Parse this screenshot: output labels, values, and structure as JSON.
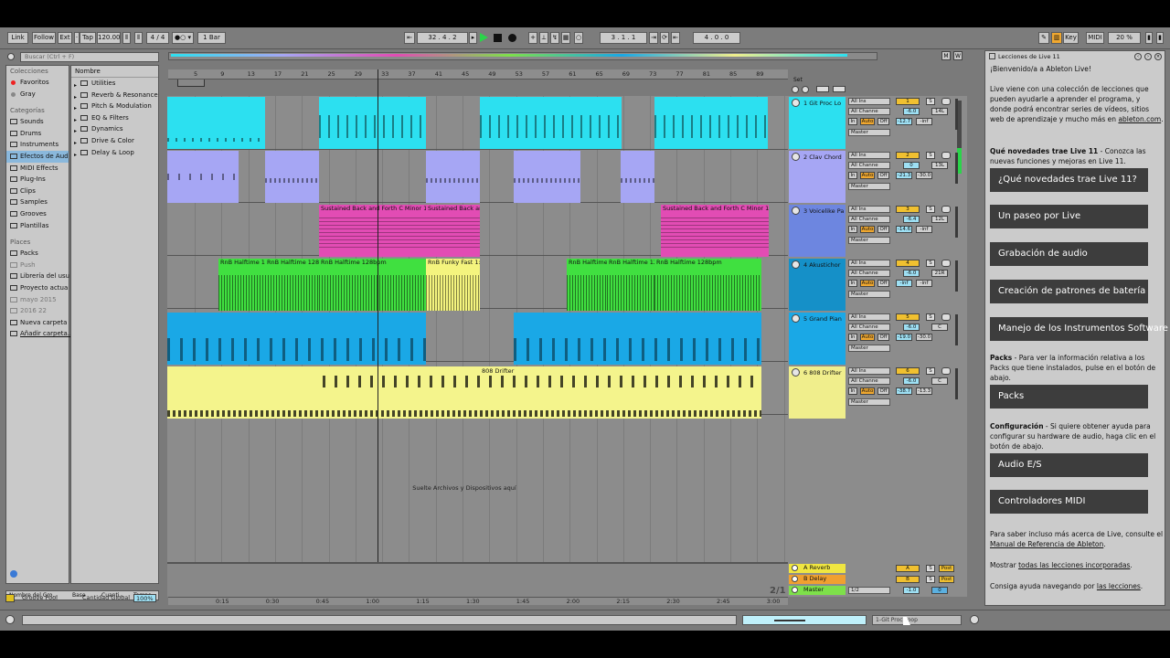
{
  "transport": {
    "link": "Link",
    "follow": "Follow",
    "ext": "Ext",
    "tap": "Tap",
    "tempo": "120.00",
    "meter": "4 / 4",
    "quant": "1 Bar",
    "position": "32 .  4 .  2",
    "loop_start": "3 .  1 .  1",
    "loop_length": "4 .  0 .  0",
    "key": "Key",
    "midi": "MIDI",
    "cpu": "20 %"
  },
  "browser": {
    "search_placeholder": "Buscar (Ctrl + F)",
    "colecciones_header": "Colecciones",
    "colecciones": [
      "Favoritos",
      "Gray"
    ],
    "categorias_header": "Categorías",
    "categorias": [
      "Sounds",
      "Drums",
      "Instruments",
      "Efectos de Aud",
      "MIDI Effects",
      "Plug-Ins",
      "Clips",
      "Samples",
      "Grooves",
      "Plantillas"
    ],
    "places_header": "Places",
    "places": [
      "Packs",
      "Push",
      "Librería del usu",
      "Proyecto actua",
      "mayo 2015",
      "2016 22",
      "Nueva carpeta",
      "Añadir carpeta..."
    ],
    "name_header": "Nombre",
    "items": [
      "Utilities",
      "Reverb & Resonance",
      "Pitch & Modulation",
      "EQ & Filters",
      "Dynamics",
      "Drive & Color",
      "Delay & Loop"
    ],
    "groove_cols": [
      "Nombre del Gro...",
      "Base",
      "Cuanti...",
      "Tempo..."
    ],
    "groove_pool": "Groove Pool",
    "global_amount_label": "Cantidad Global",
    "global_amount": "100%"
  },
  "arrangement": {
    "bars": [
      "5",
      "9",
      "13",
      "17",
      "21",
      "25",
      "29",
      "33",
      "37",
      "41",
      "45",
      "49",
      "53",
      "57",
      "61",
      "65",
      "69",
      "73",
      "77",
      "81",
      "85",
      "89"
    ],
    "set_label": "Set",
    "drop_hint": "Suelte Archivos y Dispositivos aquí",
    "time_labels": [
      "0:15",
      "0:30",
      "0:45",
      "1:00",
      "1:15",
      "1:30",
      "1:45",
      "2:00",
      "2:15",
      "2:30",
      "2:45",
      "3:00"
    ],
    "zoom": "2/1",
    "status_track": "1-Git Proc Loop"
  },
  "tracks": [
    {
      "name": "1 Git Proc Lo",
      "color": "#2ce0f0",
      "num": "1",
      "vol": "-6.0",
      "pan": "14L",
      "send_a": "-12.7",
      "send_b": "-inf",
      "in_type": "All Ins",
      "in_ch": "All Channe",
      "out": "Master"
    },
    {
      "name": "2 Clav Chord",
      "color": "#a6a6f4",
      "num": "2",
      "vol": "0",
      "pan": "13L",
      "send_a": "-21.3",
      "send_b": "-30.0",
      "in_type": "All Ins",
      "in_ch": "All Channe",
      "out": "Master"
    },
    {
      "name": "3 Voicelike Pa",
      "color": "#6d86e0",
      "num": "3",
      "vol": "-6.4",
      "pan": "12L",
      "send_a": "-14.6",
      "send_b": "-inf",
      "in_type": "All Ins",
      "in_ch": "All Channe",
      "out": "Master"
    },
    {
      "name": "4 Akustichor",
      "color": "#1590c8",
      "num": "4",
      "vol": "-6.0",
      "pan": "21R",
      "send_a": "-inf",
      "send_b": "-inf",
      "in_type": "All Ins",
      "in_ch": "All Channe",
      "out": "Master"
    },
    {
      "name": "5 Grand Pian",
      "color": "#1aa8e6",
      "num": "5",
      "vol": "-6.0",
      "pan": "C",
      "send_a": "-19.0",
      "send_b": "-30.0",
      "in_type": "All Ins",
      "in_ch": "All Channe",
      "out": "Master"
    },
    {
      "name": "6 808 Drifter",
      "color": "#f0ee8c",
      "num": "6",
      "vol": "-6.0",
      "pan": "C",
      "send_a": "-38.7",
      "send_b": "-13.3",
      "in_type": "All Ins",
      "in_ch": "All Channe",
      "out": "Master"
    }
  ],
  "clip_labels": {
    "sustained": "Sustained Back and Forth C Minor 1",
    "sustained_short": "Sustained Back an",
    "rnb": "RnB Halftime 128bpm",
    "rnb_short": "RnB Halftime 1:",
    "rnb_mid": "RnB Halftime 128",
    "funky": "RnB Funky Fast 1:",
    "drifter": "808 Drifter"
  },
  "returns": [
    {
      "name": "A Reverb",
      "num": "A",
      "color": "#f0e641"
    },
    {
      "name": "B Delay",
      "num": "B",
      "color": "#f0a030"
    },
    {
      "name": "Master",
      "num": "",
      "color": "#7ee04a",
      "vol": "-1.0",
      "pan": "0",
      "out": "1/2"
    }
  ],
  "mixer_labels": {
    "solo": "S",
    "in": "In",
    "auto": "Auto",
    "off": "Off",
    "post": "Post"
  },
  "lessons": {
    "title": "Lecciones de Live 11",
    "welcome": "¡Bienvenido/a a Ableton Live!",
    "intro": "Live viene con una colección de lecciones que pueden ayudarle a aprender el programa, y donde podrá encontrar series de vídeos, sitios web de aprendizaje y mucho más en",
    "intro_link": "ableton.com",
    "new_title": "Qué novedades trae Live 11",
    "new_text": " - Conozca las nuevas funciones y mejoras en Live 11.",
    "buttons": [
      "¿Qué novedades trae Live 11?",
      "Un paseo por Live",
      "Grabación de audio",
      "Creación de patrones de batería",
      "Manejo de los Instrumentos Software"
    ],
    "packs_title": "Packs",
    "packs_text": " - Para ver la información relativa a los Packs que tiene instalados, pulse en el botón de abajo.",
    "packs_button": "Packs",
    "config_title": "Configuración",
    "config_text": " - Si quiere obtener ayuda para configurar su hardware de audio, haga clic en el botón de abajo.",
    "audio_button": "Audio E/S",
    "midi_button": "Controladores MIDI",
    "more_text": "Para saber incluso más acerca de Live, consulte el",
    "manual_link": "Manual de Referencia de Ableton",
    "show_text": "Mostrar",
    "all_lessons_link": "todas las lecciones incorporadas",
    "help_text": "Consiga ayuda navegando por",
    "lessons_link": "las lecciones"
  }
}
